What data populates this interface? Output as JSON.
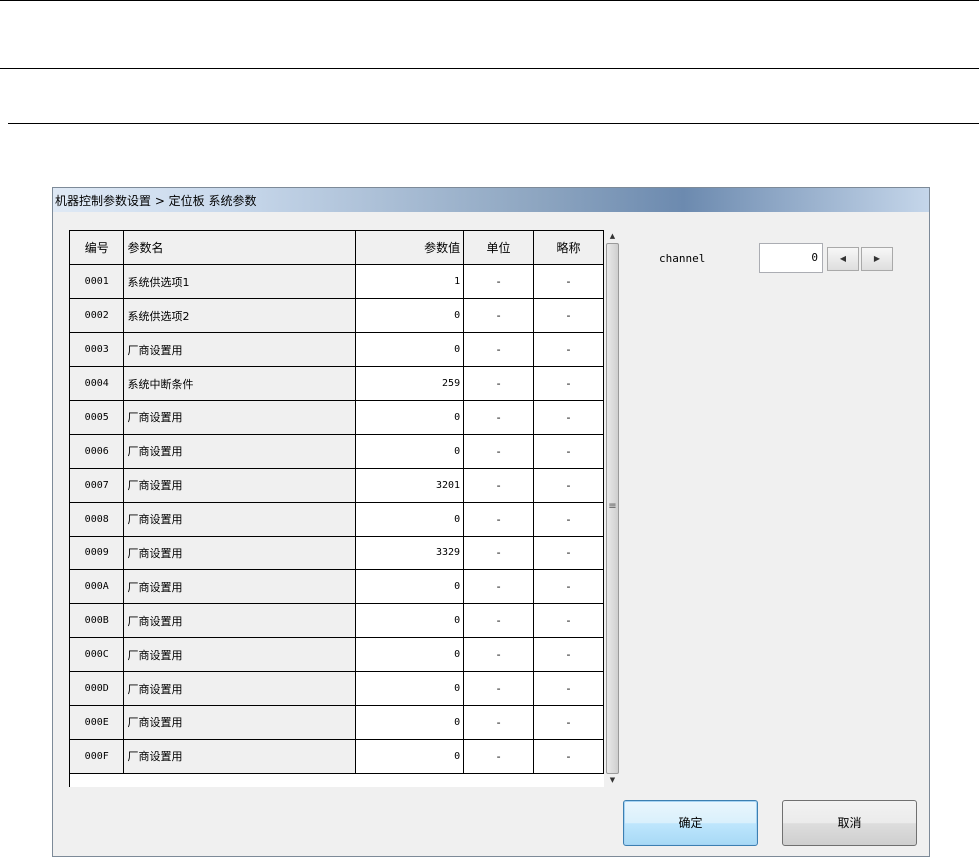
{
  "dialog": {
    "title": "机器控制参数设置 > 定位板 系统参数",
    "ok_label": "确定",
    "cancel_label": "取消"
  },
  "table": {
    "headers": {
      "code": "编号",
      "name": "参数名",
      "value": "参数值",
      "unit": "单位",
      "abbr": "略称"
    },
    "rows": [
      {
        "code": "0001",
        "name": "系统供选项1",
        "value": "1",
        "unit": "-",
        "abbr": "-"
      },
      {
        "code": "0002",
        "name": "系统供选项2",
        "value": "0",
        "unit": "-",
        "abbr": "-"
      },
      {
        "code": "0003",
        "name": "厂商设置用",
        "value": "0",
        "unit": "-",
        "abbr": "-"
      },
      {
        "code": "0004",
        "name": "系统中断条件",
        "value": "259",
        "unit": "-",
        "abbr": "-"
      },
      {
        "code": "0005",
        "name": "厂商设置用",
        "value": "0",
        "unit": "-",
        "abbr": "-"
      },
      {
        "code": "0006",
        "name": "厂商设置用",
        "value": "0",
        "unit": "-",
        "abbr": "-"
      },
      {
        "code": "0007",
        "name": "厂商设置用",
        "value": "3201",
        "unit": "-",
        "abbr": "-"
      },
      {
        "code": "0008",
        "name": "厂商设置用",
        "value": "0",
        "unit": "-",
        "abbr": "-"
      },
      {
        "code": "0009",
        "name": "厂商设置用",
        "value": "3329",
        "unit": "-",
        "abbr": "-"
      },
      {
        "code": "000A",
        "name": "厂商设置用",
        "value": "0",
        "unit": "-",
        "abbr": "-"
      },
      {
        "code": "000B",
        "name": "厂商设置用",
        "value": "0",
        "unit": "-",
        "abbr": "-"
      },
      {
        "code": "000C",
        "name": "厂商设置用",
        "value": "0",
        "unit": "-",
        "abbr": "-"
      },
      {
        "code": "000D",
        "name": "厂商设置用",
        "value": "0",
        "unit": "-",
        "abbr": "-"
      },
      {
        "code": "000E",
        "name": "厂商设置用",
        "value": "0",
        "unit": "-",
        "abbr": "-"
      },
      {
        "code": "000F",
        "name": "厂商设置用",
        "value": "0",
        "unit": "-",
        "abbr": "-"
      }
    ]
  },
  "channel": {
    "label": "channel",
    "value": "0"
  },
  "icons": {
    "spin_left": "left-arrow-icon",
    "spin_right": "right-arrow-icon",
    "scroll_up": "scroll-up-icon",
    "scroll_down": "scroll-down-icon",
    "scroll_grip": "scroll-grip-icon"
  },
  "colors": {
    "title_gradient_dark": "#6c8aaf",
    "primary_button": "#a7d9f5",
    "dialog_bg": "#f0f0f0"
  }
}
